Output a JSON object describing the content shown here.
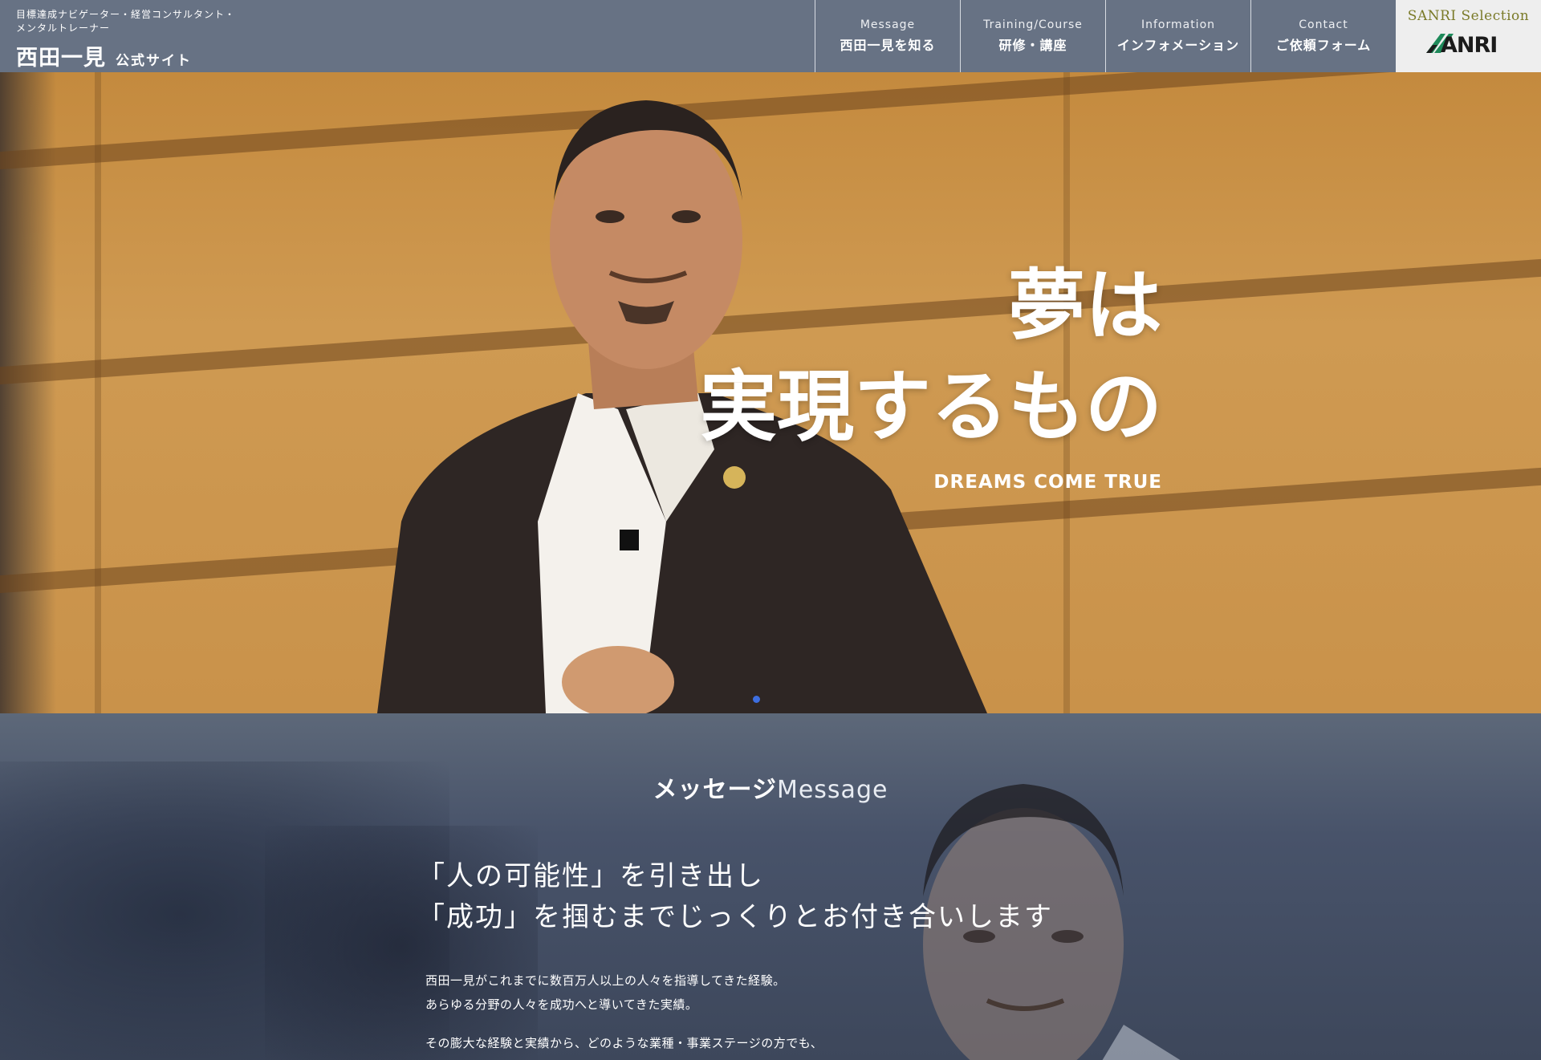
{
  "header": {
    "subtitle_line1": "目標達成ナビゲーター・経営コンサルタント・",
    "subtitle_line2": "メンタルトレーナー",
    "name": "西田一見",
    "name_suffix": "公式サイト"
  },
  "nav": [
    {
      "en": "Message",
      "ja": "西田一見を知る"
    },
    {
      "en": "Training/Course",
      "ja": "研修・講座"
    },
    {
      "en": "Information",
      "ja": "インフォメーション"
    },
    {
      "en": "Contact",
      "ja": "ご依頼フォーム"
    }
  ],
  "sanri": {
    "selection_label": "SANRI Selection",
    "logo_text": "SANRI"
  },
  "hero": {
    "line1": "夢は",
    "line2": "実現するもの",
    "english": "DREAMS COME TRUE"
  },
  "message": {
    "heading_ja": "メッセージ",
    "heading_en": "Message",
    "lead_line1": "「人の可能性」を引き出し",
    "lead_line2": "「成功」を掴むまでじっくりとお付き合いします",
    "body_line1": "西田一見がこれまでに数百万人以上の人々を指導してきた経験。",
    "body_line2": "あらゆる分野の人々を成功へと導いてきた実績。",
    "body_line3": "その膨大な経験と実績から、どのような業種・事業ステージの方でも、"
  },
  "colors": {
    "header_bg": "#677284",
    "accent_dot": "#3d6ee0",
    "sanri_green": "#1e8a5a",
    "sanri_gold": "#7a7a28"
  }
}
